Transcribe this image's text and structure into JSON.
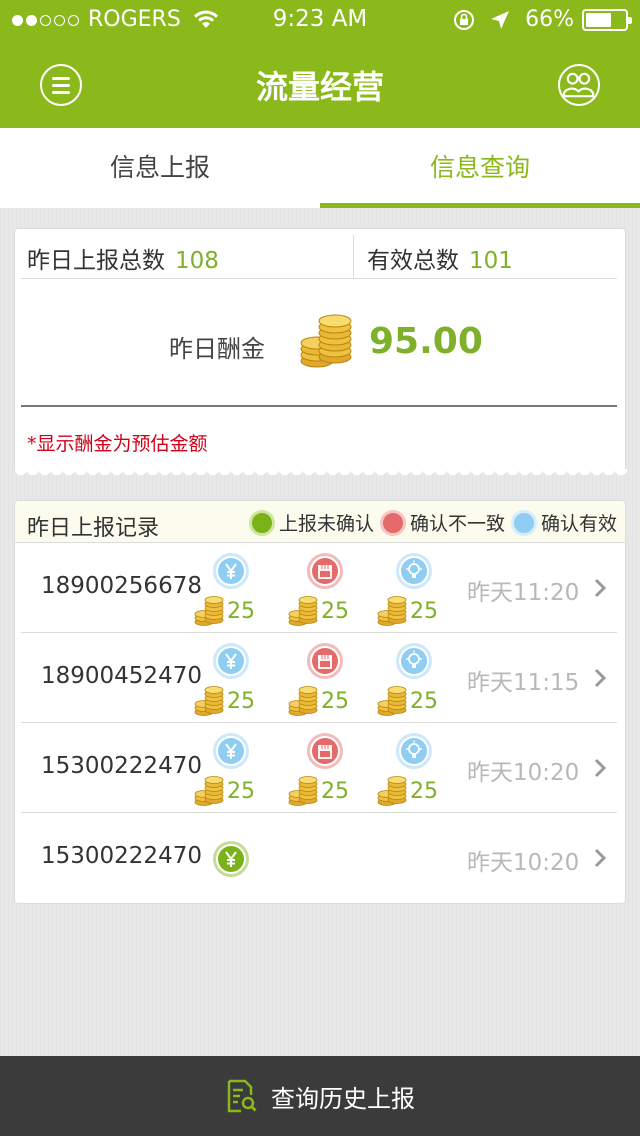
{
  "status_bar": {
    "signal_dots": [
      true,
      true,
      false,
      false,
      false
    ],
    "carrier": "ROGERS",
    "time": "9:23 AM",
    "battery_percent": 66,
    "battery_label": "66%"
  },
  "nav": {
    "title": "流量经营"
  },
  "tabs": [
    {
      "label": "信息上报",
      "active": false
    },
    {
      "label": "信息查询",
      "active": true
    }
  ],
  "summary": {
    "total_label": "昨日上报总数",
    "total_value": "108",
    "valid_label": "有效总数",
    "valid_value": "101",
    "reward_label": "昨日酬金",
    "reward_value": "95.00",
    "note": "*显示酬金为预估金额"
  },
  "records": {
    "title": "昨日上报记录",
    "legend": [
      {
        "label": "上报未确认",
        "color": "green"
      },
      {
        "label": "确认不一致",
        "color": "red"
      },
      {
        "label": "确认有效",
        "color": "blue"
      }
    ],
    "rows": [
      {
        "phone": "18900256678",
        "statuses": [
          {
            "icon": "yen-icon",
            "color": "#8fcdf2",
            "amount": "25"
          },
          {
            "icon": "store-icon",
            "color": "#e56a6a",
            "amount": "25"
          },
          {
            "icon": "bulb-icon",
            "color": "#8fcdf2",
            "amount": "25"
          }
        ],
        "time": "昨天11:20"
      },
      {
        "phone": "18900452470",
        "statuses": [
          {
            "icon": "yen-icon",
            "color": "#8fcdf2",
            "amount": "25"
          },
          {
            "icon": "store-icon",
            "color": "#e56a6a",
            "amount": "25"
          },
          {
            "icon": "bulb-icon",
            "color": "#8fcdf2",
            "amount": "25"
          }
        ],
        "time": "昨天11:15"
      },
      {
        "phone": "15300222470",
        "statuses": [
          {
            "icon": "yen-icon",
            "color": "#8fcdf2",
            "amount": "25"
          },
          {
            "icon": "store-icon",
            "color": "#e56a6a",
            "amount": "25"
          },
          {
            "icon": "bulb-icon",
            "color": "#8fcdf2",
            "amount": "25"
          }
        ],
        "time": "昨天10:20"
      },
      {
        "phone": "15300222470",
        "statuses": [
          {
            "icon": "yen-icon",
            "color": "#7ab317"
          }
        ],
        "time": "昨天10:20"
      }
    ]
  },
  "bottom": {
    "history_label": "查询历史上报"
  },
  "colors": {
    "brand": "#8bb81a",
    "value_green": "#7fb02a",
    "warning_red": "#d0021b"
  }
}
